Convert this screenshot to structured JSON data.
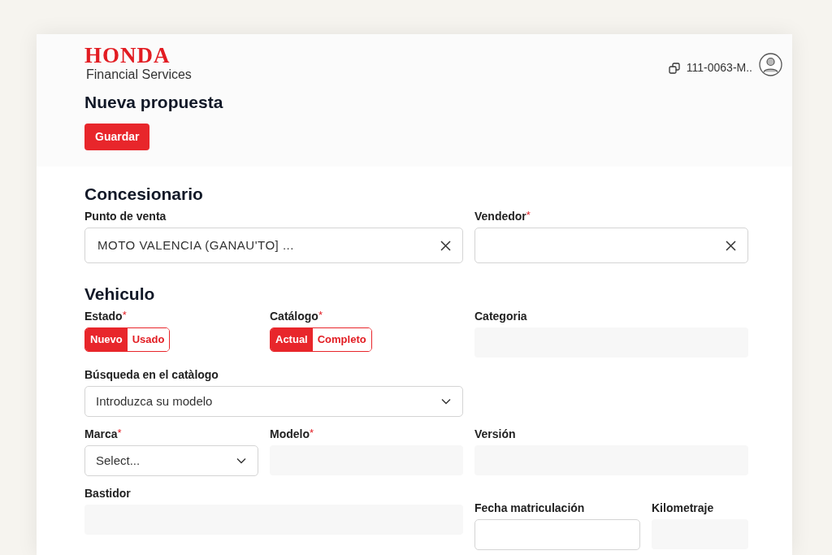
{
  "header": {
    "logo": {
      "brand": "HONDA",
      "subtitle": "Financial Services"
    },
    "account": {
      "label": "111-0063-M.."
    }
  },
  "page": {
    "title": "Nueva propuesta",
    "actions": [
      {
        "label": "Guardar"
      }
    ]
  },
  "sections": [
    {
      "title": "Concesionario",
      "fields": [
        {
          "kind": "clearable",
          "label": "Punto de venta",
          "value": "MOTO VALENCIA (GANAU'TO] ..."
        },
        {
          "kind": "clearable",
          "label": "Vendedor",
          "mark": "*"
        }
      ]
    },
    {
      "title": "Vehiculo",
      "fields": [
        {
          "kind": "segmented",
          "label": "Estado",
          "mark": "*",
          "options": [
            {
              "label": "Nuevo",
              "selected": true
            },
            {
              "label": "Usado",
              "selected": false
            }
          ]
        },
        {
          "kind": "segmented",
          "label": "Catálogo",
          "mark": "*",
          "options": [
            {
              "label": "Actual",
              "selected": true
            },
            {
              "label": "Completo",
              "selected": false
            }
          ]
        },
        {
          "kind": "readonly",
          "label": "Categoria"
        },
        {
          "kind": "select",
          "label": "Búsqueda en el catàlogo",
          "placeholder": "Introduzca su modelo"
        },
        {
          "kind": "select",
          "label": "Marca",
          "mark": "*",
          "placeholder": "Select..."
        },
        {
          "kind": "readonly",
          "label": "Modelo",
          "mark": "*"
        },
        {
          "kind": "readonly",
          "label": "Versión"
        },
        {
          "kind": "readonly",
          "label": "Bastidor"
        },
        {
          "kind": "date",
          "label": "Fecha matriculación"
        },
        {
          "kind": "readonly",
          "label": "Kilometraje"
        }
      ]
    }
  ]
}
